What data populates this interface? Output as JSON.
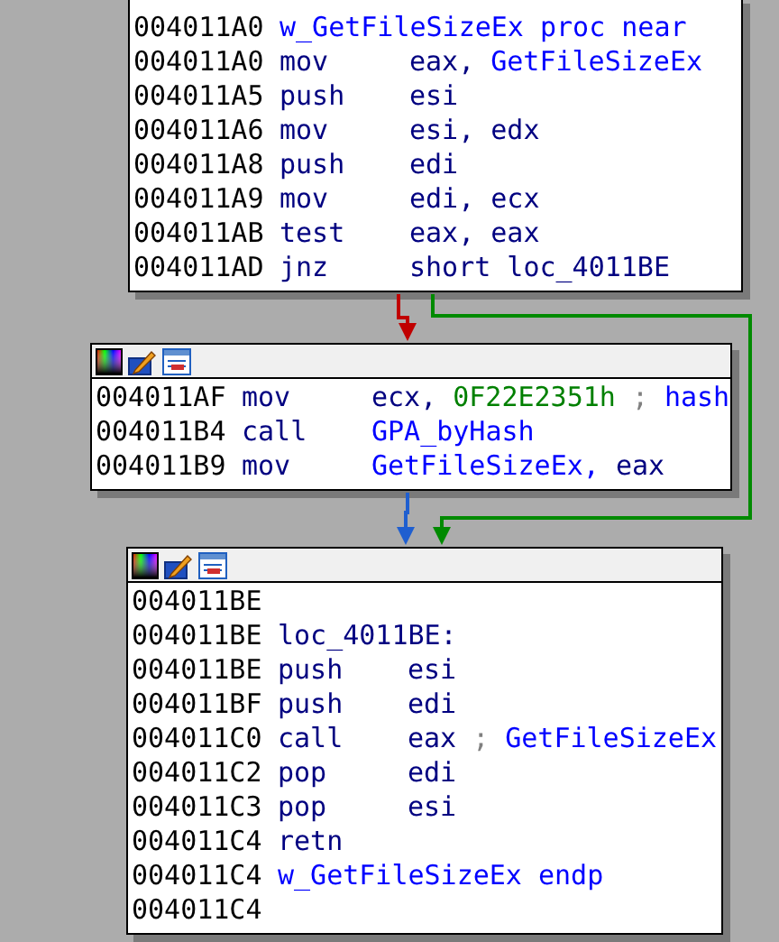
{
  "blocks": [
    {
      "header": false,
      "lines": [
        {
          "kind": "label",
          "address": "004011A0",
          "parts": [
            {
              "text": "w_GetFileSizeEx proc near",
              "kind": "name"
            }
          ]
        },
        {
          "kind": "instruction",
          "address": "004011A0",
          "mnemonic": "mov",
          "parts": [
            {
              "text": "eax,",
              "kind": "operand"
            },
            {
              "text": "GetFileSizeEx",
              "kind": "name"
            }
          ]
        },
        {
          "kind": "instruction",
          "address": "004011A5",
          "mnemonic": "push",
          "parts": [
            {
              "text": "esi",
              "kind": "operand"
            }
          ]
        },
        {
          "kind": "instruction",
          "address": "004011A6",
          "mnemonic": "mov",
          "parts": [
            {
              "text": "esi, edx",
              "kind": "operand"
            }
          ]
        },
        {
          "kind": "instruction",
          "address": "004011A8",
          "mnemonic": "push",
          "parts": [
            {
              "text": "edi",
              "kind": "operand"
            }
          ]
        },
        {
          "kind": "instruction",
          "address": "004011A9",
          "mnemonic": "mov",
          "parts": [
            {
              "text": "edi, ecx",
              "kind": "operand"
            }
          ]
        },
        {
          "kind": "instruction",
          "address": "004011AB",
          "mnemonic": "test",
          "parts": [
            {
              "text": "eax, eax",
              "kind": "operand"
            }
          ]
        },
        {
          "kind": "instruction",
          "address": "004011AD",
          "mnemonic": "jnz",
          "parts": [
            {
              "text": "short loc_4011BE",
              "kind": "operand"
            }
          ]
        }
      ]
    },
    {
      "header": true,
      "lines": [
        {
          "kind": "instruction",
          "address": "004011AF",
          "mnemonic": "mov",
          "parts": [
            {
              "text": "ecx,",
              "kind": "operand"
            },
            {
              "text": "0F22E2351h",
              "kind": "number"
            },
            {
              "text": ";",
              "kind": "comment"
            },
            {
              "text": "hash",
              "kind": "name"
            }
          ]
        },
        {
          "kind": "instruction",
          "address": "004011B4",
          "mnemonic": "call",
          "parts": [
            {
              "text": "GPA_byHash",
              "kind": "name"
            }
          ]
        },
        {
          "kind": "instruction",
          "address": "004011B9",
          "mnemonic": "mov",
          "parts": [
            {
              "text": "GetFileSizeEx,",
              "kind": "name"
            },
            {
              "text": "eax",
              "kind": "operand"
            }
          ]
        }
      ]
    },
    {
      "header": true,
      "lines": [
        {
          "kind": "empty",
          "address": "004011BE"
        },
        {
          "kind": "label",
          "address": "004011BE",
          "parts": [
            {
              "text": "loc_4011BE:",
              "kind": "operand"
            }
          ]
        },
        {
          "kind": "instruction",
          "address": "004011BE",
          "mnemonic": "push",
          "parts": [
            {
              "text": "esi",
              "kind": "operand"
            }
          ]
        },
        {
          "kind": "instruction",
          "address": "004011BF",
          "mnemonic": "push",
          "parts": [
            {
              "text": "edi",
              "kind": "operand"
            }
          ]
        },
        {
          "kind": "instruction",
          "address": "004011C0",
          "mnemonic": "call",
          "parts": [
            {
              "text": "eax",
              "kind": "operand"
            },
            {
              "text": ";",
              "kind": "comment"
            },
            {
              "text": "GetFileSizeEx",
              "kind": "name"
            }
          ]
        },
        {
          "kind": "instruction",
          "address": "004011C2",
          "mnemonic": "pop",
          "parts": [
            {
              "text": "edi",
              "kind": "operand"
            }
          ]
        },
        {
          "kind": "instruction",
          "address": "004011C3",
          "mnemonic": "pop",
          "parts": [
            {
              "text": "esi",
              "kind": "operand"
            }
          ]
        },
        {
          "kind": "instruction",
          "address": "004011C4",
          "mnemonic": "retn"
        },
        {
          "kind": "label",
          "address": "004011C4",
          "parts": [
            {
              "text": "w_GetFileSizeEx endp",
              "kind": "name"
            }
          ]
        },
        {
          "kind": "empty",
          "address": "004011C4"
        }
      ]
    }
  ],
  "edges": [
    {
      "color": "#c00000"
    },
    {
      "color": "#008a00"
    },
    {
      "color": "#1f5fd0"
    }
  ]
}
